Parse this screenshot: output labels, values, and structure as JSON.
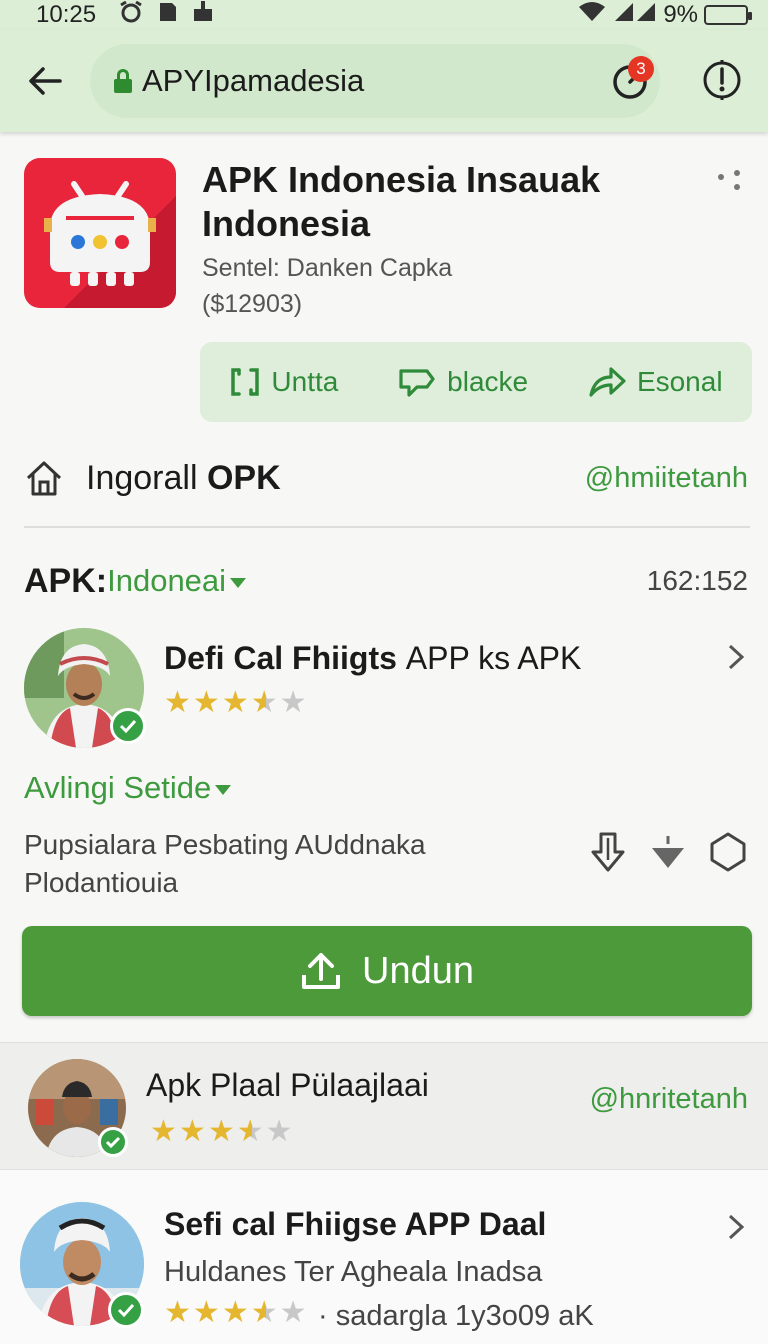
{
  "status": {
    "time": "10:25",
    "battery": "9%",
    "battery_level": 0.9
  },
  "browser": {
    "url": "APYIpamadesia",
    "badge_count": "3"
  },
  "app": {
    "name": "APK Indonesia Insauak Indonesia",
    "subtitle": "Sentel: Danken Capka",
    "price": "($12903)"
  },
  "actions": [
    {
      "label": "Untta",
      "icon": "bracket-icon"
    },
    {
      "label": "blacke",
      "icon": "flag-icon"
    },
    {
      "label": "Esonal",
      "icon": "share-icon"
    }
  ],
  "install": {
    "label_a": "Ingorall ",
    "label_b": "OPK",
    "handle": "@hmiitetanh"
  },
  "section": {
    "prefix": "APK:",
    "selector": "Indoneai",
    "count": "162:152"
  },
  "featured": {
    "title_bold": "Defi Cal Fhiigts ",
    "title_light": "APP ks APK",
    "rating": 3.5
  },
  "availability": "Avlingi Setide",
  "description": "Pupsialara Pesbating AUddnaka Plodantiouia",
  "download_label": "Undun",
  "list": [
    {
      "title": "Apk Plaal Pülaajlaai",
      "handle": "@hnritetanh",
      "rating": 3.5
    },
    {
      "title": "Sefi cal Fhiigse APP Daal",
      "subtitle": "Huldanes Ter Agheala Inadsa",
      "rating": 3.5,
      "meta": "· sadargla 1y3o09 aK"
    }
  ],
  "colors": {
    "accent": "#3e9a3f",
    "appbar": "#dcefd6",
    "button": "#4c9a3a",
    "icon_bg": "#e8253b",
    "star": "#e5b62f"
  }
}
